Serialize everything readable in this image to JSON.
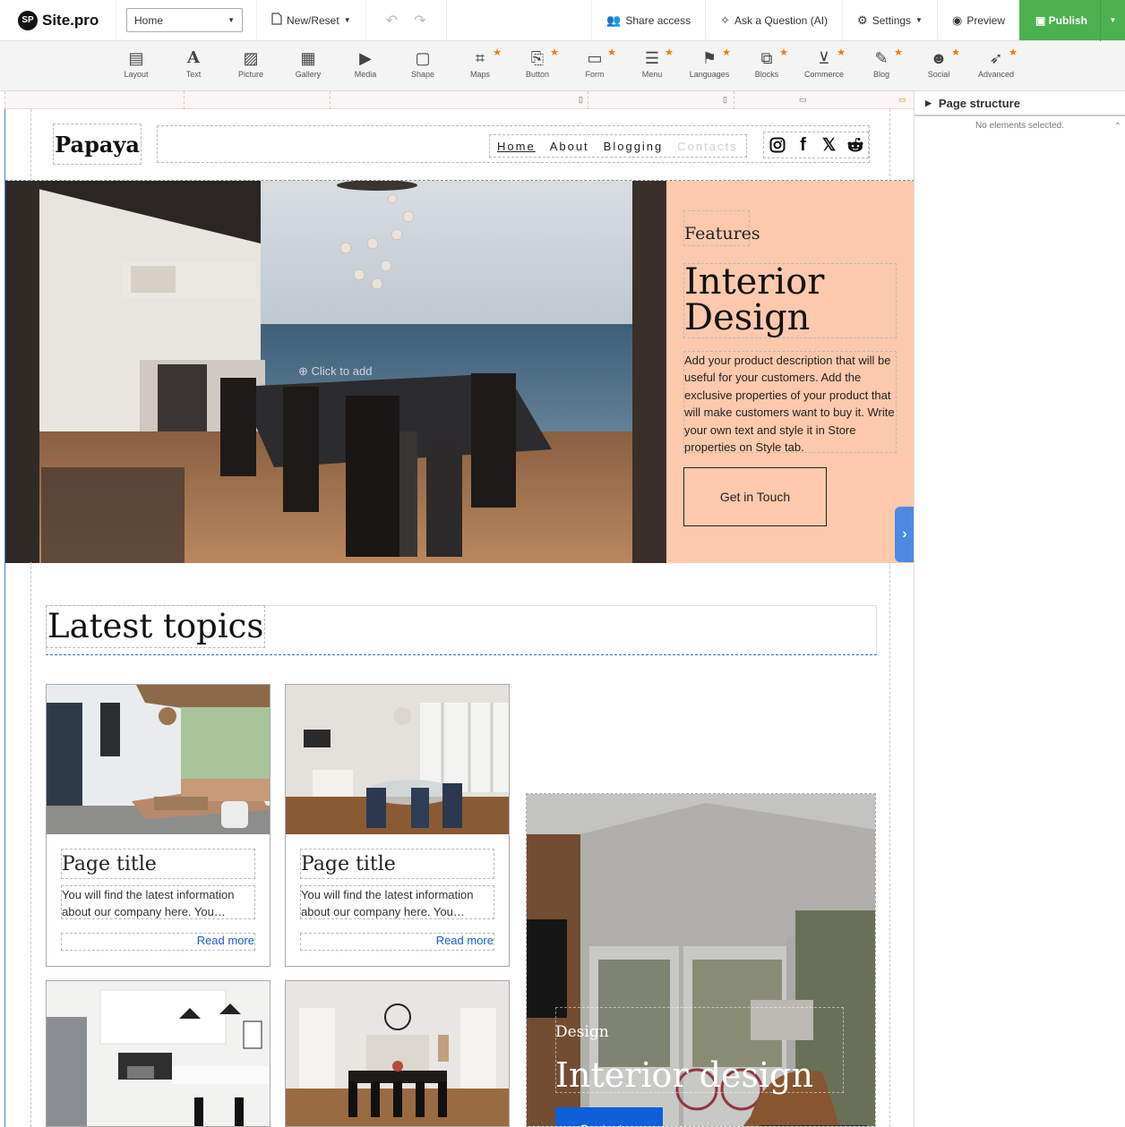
{
  "app": {
    "name": "Site.pro",
    "badge": "SP"
  },
  "topbar": {
    "page_select": "Home",
    "new_reset": "New/Reset",
    "share": "Share access",
    "ask": "Ask a Question (AI)",
    "settings": "Settings",
    "preview": "Preview",
    "publish": "Publish",
    "publish_color": "#4cb050"
  },
  "toolbar": {
    "items": [
      {
        "label": "Layout",
        "icon": "layout-icon",
        "star": false
      },
      {
        "label": "Text",
        "icon": "text-icon",
        "star": false
      },
      {
        "label": "Picture",
        "icon": "picture-icon",
        "star": false
      },
      {
        "label": "Gallery",
        "icon": "gallery-icon",
        "star": false
      },
      {
        "label": "Media",
        "icon": "media-icon",
        "star": false
      },
      {
        "label": "Shape",
        "icon": "shape-icon",
        "star": false
      },
      {
        "label": "Maps",
        "icon": "maps-icon",
        "star": true
      },
      {
        "label": "Button",
        "icon": "button-icon",
        "star": true
      },
      {
        "label": "Form",
        "icon": "form-icon",
        "star": true
      },
      {
        "label": "Menu",
        "icon": "menu-icon",
        "star": true
      },
      {
        "label": "Languages",
        "icon": "languages-icon",
        "star": true
      },
      {
        "label": "Blocks",
        "icon": "blocks-icon",
        "star": true
      },
      {
        "label": "Commerce",
        "icon": "cart-icon",
        "star": true
      },
      {
        "label": "Blog",
        "icon": "blog-icon",
        "star": true
      },
      {
        "label": "Social",
        "icon": "social-icon",
        "star": true
      },
      {
        "label": "Advanced",
        "icon": "rocket-icon",
        "star": true
      }
    ],
    "star_color": "#f07a10"
  },
  "panel": {
    "title": "Page structure",
    "empty": "No elements selected."
  },
  "site": {
    "brand": "Papaya",
    "nav": {
      "home": "Home",
      "about": "About",
      "blogging": "Blogging",
      "contacts": "Contacts"
    },
    "hero": {
      "kicker": "Features",
      "title": "Interior Design",
      "description": "Add your product description that will be useful for your customers. Add the exclusive properties of your product that will make customers want to buy it. Write your own text and style it in Store properties on Style tab.",
      "button": "Get in Touch",
      "click_to_add": "Click to add",
      "bg_color": "#fdc9ad"
    },
    "latest": {
      "title": "Latest topics"
    },
    "cards": [
      {
        "title": "Page title",
        "text": "You will find the latest information about our company here. You…",
        "link": "Read more"
      },
      {
        "title": "Page title",
        "text": "You will find the latest information about our company here. You…",
        "link": "Read more"
      }
    ],
    "feature": {
      "tag": "Design",
      "title": "Interior design",
      "button": "Contact us",
      "button_color": "#0e5fd8"
    }
  }
}
